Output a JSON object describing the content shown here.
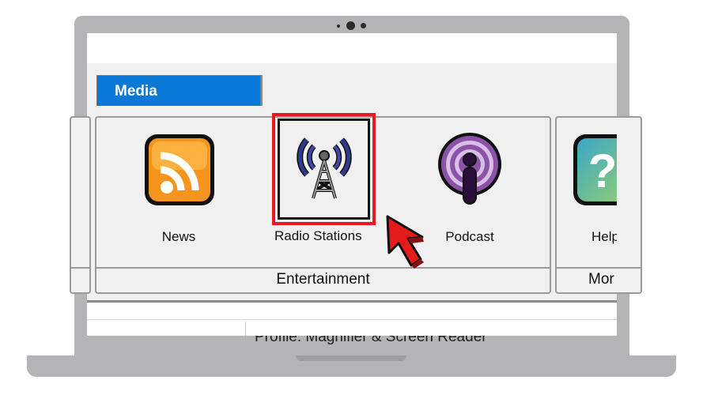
{
  "ribbon": {
    "active_tab": "Media",
    "groups": [
      {
        "label": ""
      },
      {
        "label": "Entertainment"
      },
      {
        "label": "Mor"
      }
    ],
    "items": [
      {
        "label": "News",
        "icon": "rss-icon",
        "color": "#f7941d"
      },
      {
        "label": "Radio Stations",
        "icon": "radio-tower-icon",
        "selected": true
      },
      {
        "label": "Podcast",
        "icon": "podcast-icon",
        "color": "#7b3f98"
      },
      {
        "label": "Help",
        "icon": "help-icon"
      }
    ]
  },
  "profile": {
    "label": "Profile: Magnifier & Screen Reader"
  },
  "colors": {
    "tab_active": "#0a78d7",
    "highlight": "#e31b1b",
    "cursor": "#e31b1b"
  }
}
